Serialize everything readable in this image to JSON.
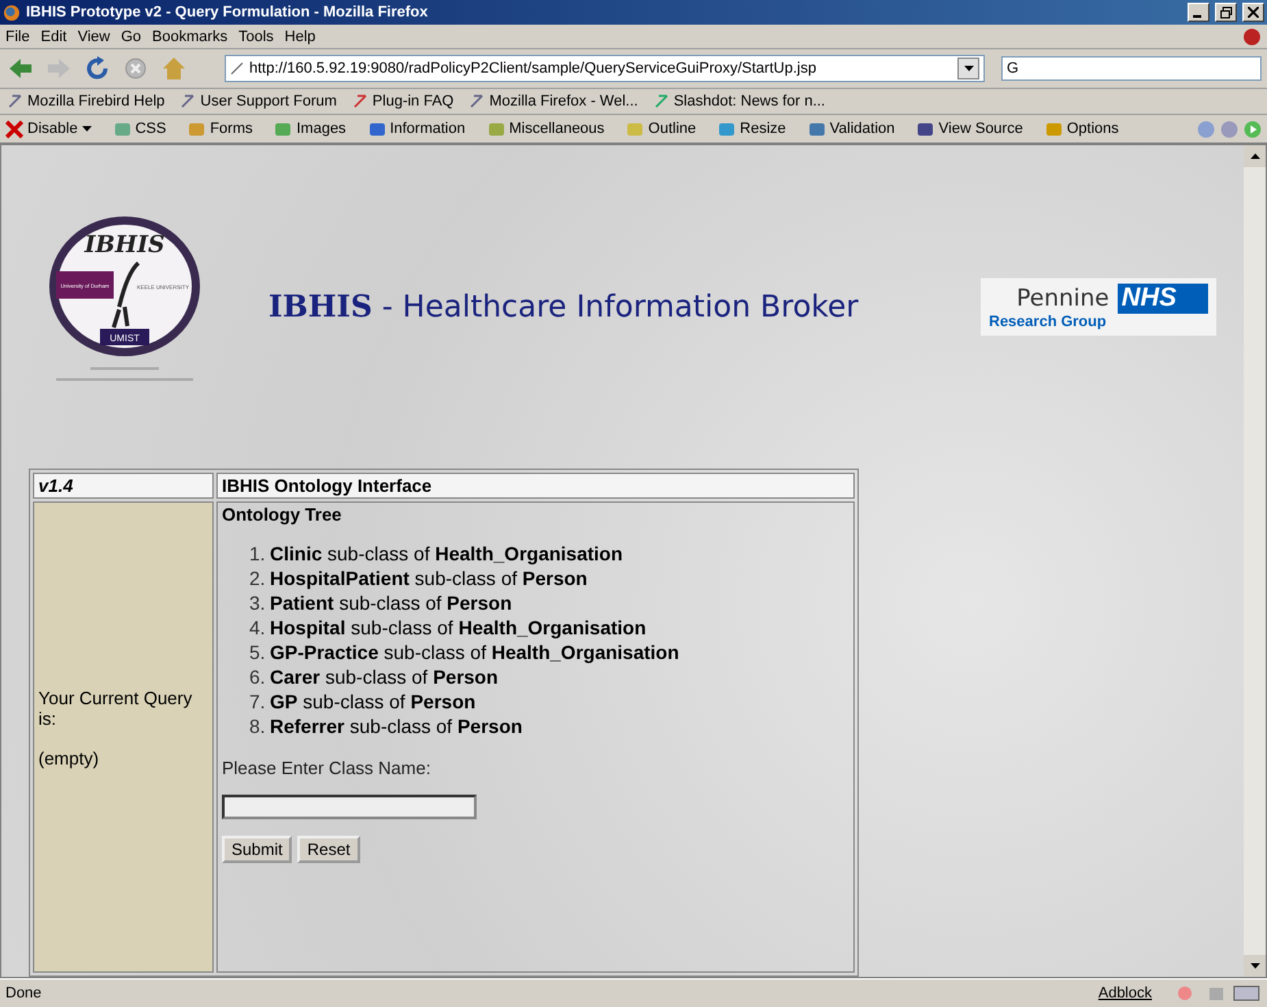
{
  "window": {
    "title": "IBHIS Prototype v2 - Query Formulation - Mozilla Firefox"
  },
  "menu": [
    "File",
    "Edit",
    "View",
    "Go",
    "Bookmarks",
    "Tools",
    "Help"
  ],
  "address": {
    "value": "http://160.5.92.19:9080/radPolicyP2Client/sample/QueryServiceGuiProxy/StartUp.jsp"
  },
  "search": {
    "value": "G"
  },
  "bookmarks": [
    {
      "label": "Mozilla Firebird Help"
    },
    {
      "label": "User Support Forum"
    },
    {
      "label": "Plug-in FAQ"
    },
    {
      "label": "Mozilla Firefox - Wel..."
    },
    {
      "label": "Slashdot: News for n..."
    }
  ],
  "dev_toolbar": [
    {
      "label": "Disable",
      "dropdown": true
    },
    {
      "label": "CSS",
      "dropdown": false
    },
    {
      "label": "Forms",
      "dropdown": false
    },
    {
      "label": "Images",
      "dropdown": false
    },
    {
      "label": "Information",
      "dropdown": false
    },
    {
      "label": "Miscellaneous",
      "dropdown": false
    },
    {
      "label": "Outline",
      "dropdown": false
    },
    {
      "label": "Resize",
      "dropdown": false
    },
    {
      "label": "Validation",
      "dropdown": false
    },
    {
      "label": "View Source",
      "dropdown": false
    },
    {
      "label": "Options",
      "dropdown": false
    }
  ],
  "page": {
    "logo": {
      "title": "IBHIS",
      "partners": [
        "University of Durham",
        "KEELE UNIVERSITY",
        "UMIST"
      ]
    },
    "heading": {
      "name": "IBHIS",
      "rest": " - Healthcare Information Broker"
    },
    "nhs_logo": {
      "name": "Pennine",
      "badge": "NHS",
      "subtitle": "Research Group"
    },
    "table": {
      "version": "v1.4",
      "title": "IBHIS Ontology Interface",
      "query_label": "Your Current Query is:",
      "query_value": "(empty)",
      "tree_title": "Ontology Tree",
      "items": [
        {
          "number": "1.",
          "text": "**Clinic** sub-class of **Health_Organisation**"
        },
        {
          "number": "2.",
          "text": "**HospitalPatient** sub-class of **Person**"
        },
        {
          "number": "3.",
          "text": "**Patient** sub-class of **Person**"
        },
        {
          "number": "4.",
          "text": "**Hospital** sub-class of **Health_Organisation**"
        },
        {
          "number": "5.",
          "text": "**GP-Practice** sub-class of **Health_Organisation**"
        },
        {
          "number": "6.",
          "text": "**Carer** sub-class of **Person**"
        },
        {
          "number": "7.",
          "text": "**GP** sub-class of **Person**"
        },
        {
          "number": "8.",
          "text": "**Referrer** sub-class of **Person**"
        }
      ],
      "prompt": "Please Enter Class Name:",
      "buttons": [
        "Submit",
        "Reset"
      ]
    }
  },
  "status_bar": {
    "text": "Done",
    "adblock": "Adblock"
  }
}
